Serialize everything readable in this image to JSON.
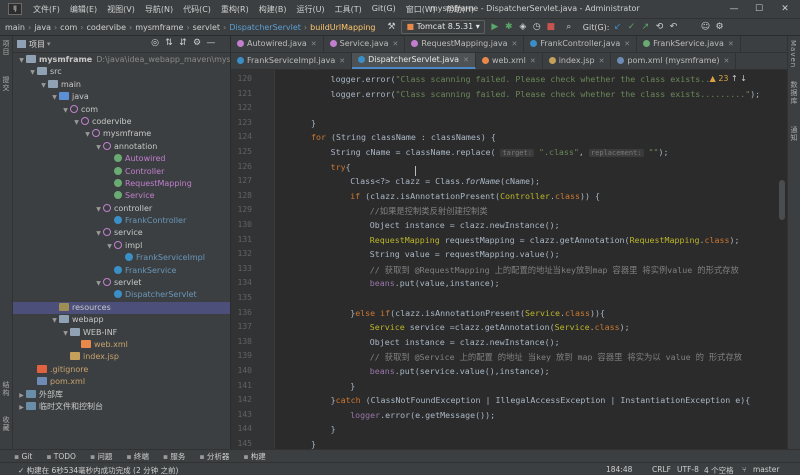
{
  "app": {
    "logo": "IJ",
    "menu": [
      "文件(F)",
      "编辑(E)",
      "视图(V)",
      "导航(N)",
      "代码(C)",
      "重构(R)",
      "构建(B)",
      "运行(U)",
      "工具(T)",
      "Git(G)",
      "窗口(W)",
      "帮助(H)"
    ],
    "window_title": "mysmframe - DispatcherServlet.java - Administrator"
  },
  "navbar": {
    "breadcrumbs": [
      "main",
      "java",
      "com",
      "codervibe",
      "mysmframe",
      "servlet",
      "DispatcherServlet",
      "buildUrlMapping"
    ],
    "run_config": "Tomcat 8.5.31",
    "git_label": "Git(G):"
  },
  "left_strip": [
    "项目",
    "提交",
    "结构",
    "收藏"
  ],
  "right_strip": [
    "Maven",
    "数据库",
    "通知"
  ],
  "project": {
    "title": "项目",
    "tree": [
      {
        "label": "mysmframe",
        "path": "D:\\java\\idea_webapp_maven\\mysmfr",
        "indent": 0,
        "icon": "folder",
        "arrow": "▼",
        "bold": true
      },
      {
        "label": "src",
        "indent": 1,
        "icon": "folder",
        "arrow": "▼"
      },
      {
        "label": "main",
        "indent": 2,
        "icon": "folder",
        "arrow": "▼"
      },
      {
        "label": "java",
        "indent": 3,
        "icon": "src",
        "arrow": "▼"
      },
      {
        "label": "com",
        "indent": 4,
        "icon": "pkg",
        "arrow": "▼"
      },
      {
        "label": "codervibe",
        "indent": 5,
        "icon": "pkg",
        "arrow": "▼"
      },
      {
        "label": "mysmframe",
        "indent": 6,
        "icon": "pkg",
        "arrow": "▼"
      },
      {
        "label": "annotation",
        "indent": 7,
        "icon": "pkg",
        "arrow": "▼"
      },
      {
        "label": "Autowired",
        "indent": 8,
        "icon": "ann",
        "arrow": "",
        "color": "#c27fcf"
      },
      {
        "label": "Controller",
        "indent": 8,
        "icon": "ann",
        "arrow": "",
        "color": "#c27fcf"
      },
      {
        "label": "RequestMapping",
        "indent": 8,
        "icon": "ann",
        "arrow": "",
        "color": "#c27fcf"
      },
      {
        "label": "Service",
        "indent": 8,
        "icon": "ann",
        "arrow": "",
        "color": "#c27fcf"
      },
      {
        "label": "controller",
        "indent": 7,
        "icon": "pkg",
        "arrow": "▼"
      },
      {
        "label": "FrankController",
        "indent": 8,
        "icon": "cls",
        "arrow": "",
        "color": "#6897bb"
      },
      {
        "label": "service",
        "indent": 7,
        "icon": "pkg",
        "arrow": "▼"
      },
      {
        "label": "impl",
        "indent": 8,
        "icon": "pkg",
        "arrow": "▼"
      },
      {
        "label": "FrankServiceImpl",
        "indent": 9,
        "icon": "cls",
        "arrow": "",
        "color": "#6897bb"
      },
      {
        "label": "FrankService",
        "indent": 8,
        "icon": "cls",
        "arrow": "",
        "color": "#6897bb"
      },
      {
        "label": "servlet",
        "indent": 7,
        "icon": "pkg",
        "arrow": "▼"
      },
      {
        "label": "DispatcherServlet",
        "indent": 8,
        "icon": "cls",
        "arrow": "",
        "color": "#6897bb"
      },
      {
        "label": "resources",
        "indent": 3,
        "icon": "res",
        "arrow": "",
        "selected": true
      },
      {
        "label": "webapp",
        "indent": 3,
        "icon": "folder",
        "arrow": "▼"
      },
      {
        "label": "WEB-INF",
        "indent": 4,
        "icon": "folder",
        "arrow": "▼"
      },
      {
        "label": "web.xml",
        "indent": 5,
        "icon": "xml",
        "arrow": "",
        "color": "#c7a26d"
      },
      {
        "label": "index.jsp",
        "indent": 4,
        "icon": "jsp",
        "arrow": "",
        "color": "#c7a26d"
      },
      {
        "label": ".gitignore",
        "indent": 1,
        "icon": "git",
        "arrow": "",
        "color": "#c7a26d"
      },
      {
        "label": "pom.xml",
        "indent": 1,
        "icon": "pom",
        "arrow": "",
        "color": "#c7a26d"
      },
      {
        "label": "外部库",
        "indent": 0,
        "icon": "lib",
        "arrow": "▶"
      },
      {
        "label": "临时文件和控制台",
        "indent": 0,
        "icon": "lib",
        "arrow": "▶"
      }
    ]
  },
  "editor": {
    "tabs_row1": [
      {
        "label": "Autowired.java",
        "color": "#c27fcf"
      },
      {
        "label": "Service.java",
        "color": "#c27fcf"
      },
      {
        "label": "RequestMapping.java",
        "color": "#c27fcf"
      },
      {
        "label": "FrankController.java",
        "color": "#3a8fc7"
      },
      {
        "label": "FrankService.java",
        "color": "#6aab73"
      }
    ],
    "tabs_row2": [
      {
        "label": "FrankServiceImpl.java",
        "color": "#3a8fc7"
      },
      {
        "label": "DispatcherServlet.java",
        "color": "#3a8fc7",
        "active": true
      },
      {
        "label": "web.xml",
        "color": "#e8894b"
      },
      {
        "label": "index.jsp",
        "color": "#c5a05a"
      },
      {
        "label": "pom.xml (mysmframe)",
        "color": "#6d8bb5"
      }
    ],
    "warning_count": "▲ 23",
    "lines": [
      {
        "n": "120",
        "ind": 6,
        "html": "logger.error(<span class='st'>\"Class scanning failed. Please check whether the class exists...</span>"
      },
      {
        "n": "121",
        "ind": 6,
        "html": "logger.error(<span class='st'>\"Class scanning failed. Please check whether the class exists.........\"</span>);"
      },
      {
        "n": "122",
        "ind": 0,
        "html": ""
      },
      {
        "n": "123",
        "ind": 5,
        "html": "}"
      },
      {
        "n": "124",
        "ind": 5,
        "html": "<span class='kw'>for</span> (String className : classNames) {"
      },
      {
        "n": "125",
        "ind": 6,
        "html": "String cName = className.replace( <span class='hint'>target:</span> <span class='st'>\".class\"</span>, <span class='hint'>replacement:</span> <span class='st'>\"\"</span>);"
      },
      {
        "n": "126",
        "ind": 6,
        "html": "<span class='kw'>try</span>{"
      },
      {
        "n": "127",
        "ind": 7,
        "html": "Class&lt;?&gt; clazz = Class.<span class='it'>forName</span>(cName);"
      },
      {
        "n": "128",
        "ind": 7,
        "html": "<span class='kw'>if</span> (clazz.isAnnotationPresent(<span class='an'>Controller</span>.<span class='kw'>class</span>)) {"
      },
      {
        "n": "129",
        "ind": 8,
        "html": "<span class='cm'>//如果是控制类反射创建控制类</span>"
      },
      {
        "n": "130",
        "ind": 8,
        "html": "Object instance = clazz.newInstance();"
      },
      {
        "n": "131",
        "ind": 8,
        "html": "<span class='an'>RequestMapping</span> requestMapping = clazz.getAnnotation(<span class='an'>RequestMapping</span>.<span class='kw'>class</span>);"
      },
      {
        "n": "132",
        "ind": 8,
        "html": "String value = requestMapping.value();"
      },
      {
        "n": "133",
        "ind": 8,
        "html": "<span class='cm'>// 获取到 @RequestMapping 上的配置的地址当key放到map 容器里 将实例value 的形式存放</span>"
      },
      {
        "n": "134",
        "ind": 8,
        "html": "<span class='fd'>beans</span>.put(value,instance);"
      },
      {
        "n": "135",
        "ind": 0,
        "html": ""
      },
      {
        "n": "136",
        "ind": 7,
        "html": "}<span class='kw'>else if</span>(clazz.isAnnotationPresent(<span class='an'>Service</span>.<span class='kw'>class</span>)){"
      },
      {
        "n": "137",
        "ind": 8,
        "html": "<span class='an'>Service</span> service =clazz.getAnnotation(<span class='an'>Service</span>.<span class='kw'>class</span>);"
      },
      {
        "n": "138",
        "ind": 8,
        "html": "Object instance = clazz.newInstance();"
      },
      {
        "n": "139",
        "ind": 8,
        "html": "<span class='cm'>// 获取到 @Service 上的配置 的地址 当key 放到 map 容器里 将实为以 value 的 形式存放</span>"
      },
      {
        "n": "140",
        "ind": 8,
        "html": "<span class='fd'>beans</span>.put(service.value(),instance);"
      },
      {
        "n": "141",
        "ind": 7,
        "html": "}"
      },
      {
        "n": "142",
        "ind": 6,
        "html": "}<span class='kw'>catch</span> (ClassNotFoundException | IllegalAccessException | InstantiationException e){"
      },
      {
        "n": "143",
        "ind": 7,
        "html": "<span class='fd'>logger</span>.error(e.getMessage());"
      },
      {
        "n": "144",
        "ind": 6,
        "html": "}"
      },
      {
        "n": "145",
        "ind": 5,
        "html": "}"
      }
    ]
  },
  "toolwindows": [
    "Git",
    "TODO",
    "问题",
    "终端",
    "服务",
    "分析器",
    "构建"
  ],
  "status": {
    "message": "✓ 构建在 6秒534毫秒内成功完成 (2 分钟 之前)",
    "position": "184:48",
    "line_sep": "CRLF",
    "encoding": "UTF-8",
    "indent": "4 个空格",
    "branch": "master"
  }
}
